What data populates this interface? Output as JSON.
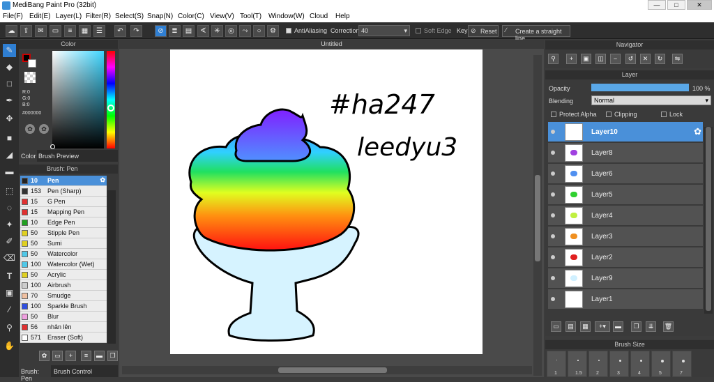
{
  "window": {
    "title": "MediBang Paint Pro (32bit)",
    "minimize": "—",
    "maximize": "□",
    "close": "✕"
  },
  "menu": [
    "File(F)",
    "Edit(E)",
    "Layer(L)",
    "Filter(R)",
    "Select(S)",
    "Snap(N)",
    "Color(C)",
    "View(V)",
    "Tool(T)",
    "Window(W)",
    "Cloud",
    "Help"
  ],
  "toolbar": {
    "antialiasing_label": "AntiAliasing",
    "correction_label": "Correction",
    "correction_value": "40",
    "soft_edge_label": "Soft Edge",
    "key_label": "Key",
    "reset_label": "Reset",
    "straight_line_label": "Create a straight line"
  },
  "color_panel": {
    "title": "Color",
    "r": "R:0",
    "g": "G:0",
    "b": "B:0",
    "hex": "#000000",
    "tab_color": "Color",
    "tab_preview": "Brush Preview"
  },
  "brush_panel": {
    "title": "Brush: Pen",
    "items": [
      {
        "size": "10",
        "name": "Pen",
        "color": "#222222",
        "selected": true
      },
      {
        "size": "153",
        "name": "Pen (Sharp)",
        "color": "#333333"
      },
      {
        "size": "15",
        "name": "G Pen",
        "color": "#e03030"
      },
      {
        "size": "15",
        "name": "Mapping Pen",
        "color": "#e03030"
      },
      {
        "size": "10",
        "name": "Edge Pen",
        "color": "#20a020"
      },
      {
        "size": "50",
        "name": "Stipple Pen",
        "color": "#e0d020"
      },
      {
        "size": "50",
        "name": "Sumi",
        "color": "#e0d020"
      },
      {
        "size": "50",
        "name": "Watercolor",
        "color": "#50c8e8"
      },
      {
        "size": "100",
        "name": "Watercolor (Wet)",
        "color": "#50c8e8"
      },
      {
        "size": "50",
        "name": "Acrylic",
        "color": "#e0d020"
      },
      {
        "size": "100",
        "name": "Airbrush",
        "color": "#cccccc"
      },
      {
        "size": "70",
        "name": "Smudge",
        "color": "#f0c0a0"
      },
      {
        "size": "100",
        "name": "Sparkle Brush",
        "color": "#3050e0"
      },
      {
        "size": "50",
        "name": "Blur",
        "color": "#f0a0e0"
      },
      {
        "size": "56",
        "name": "nhân lên",
        "color": "#e03030"
      },
      {
        "size": "571",
        "name": "Eraser (Soft)",
        "color": "#ffffff"
      }
    ],
    "tab_brush": "Brush: Pen",
    "tab_control": "Brush Control"
  },
  "canvas": {
    "tab": "Untitled",
    "text_line1": "#ha247",
    "text_line2": "leedyu3"
  },
  "navigator": {
    "title": "Navigator"
  },
  "layer_panel": {
    "title": "Layer",
    "opacity_label": "Opacity",
    "opacity_value": "100 %",
    "opacity_fraction": 1.0,
    "blending_label": "Blending",
    "blending_value": "Normal",
    "protect_alpha": "Protect Alpha",
    "clipping": "Clipping",
    "lock": "Lock",
    "layers": [
      {
        "name": "Layer10",
        "selected": true,
        "thumb": "#ffffff"
      },
      {
        "name": "Layer8",
        "thumb": "#a040e0"
      },
      {
        "name": "Layer6",
        "thumb": "#5090f0"
      },
      {
        "name": "Layer5",
        "thumb": "#30d030"
      },
      {
        "name": "Layer4",
        "thumb": "#c0f040"
      },
      {
        "name": "Layer3",
        "thumb": "#f09020"
      },
      {
        "name": "Layer2",
        "thumb": "#e02020"
      },
      {
        "name": "Layer9",
        "thumb": "#d0f0ff"
      },
      {
        "name": "Layer1",
        "thumb": "#ffffff"
      }
    ]
  },
  "brush_size": {
    "title": "Brush Size",
    "sizes": [
      "1",
      "1.5",
      "2",
      "3",
      "4",
      "5",
      "7"
    ]
  }
}
